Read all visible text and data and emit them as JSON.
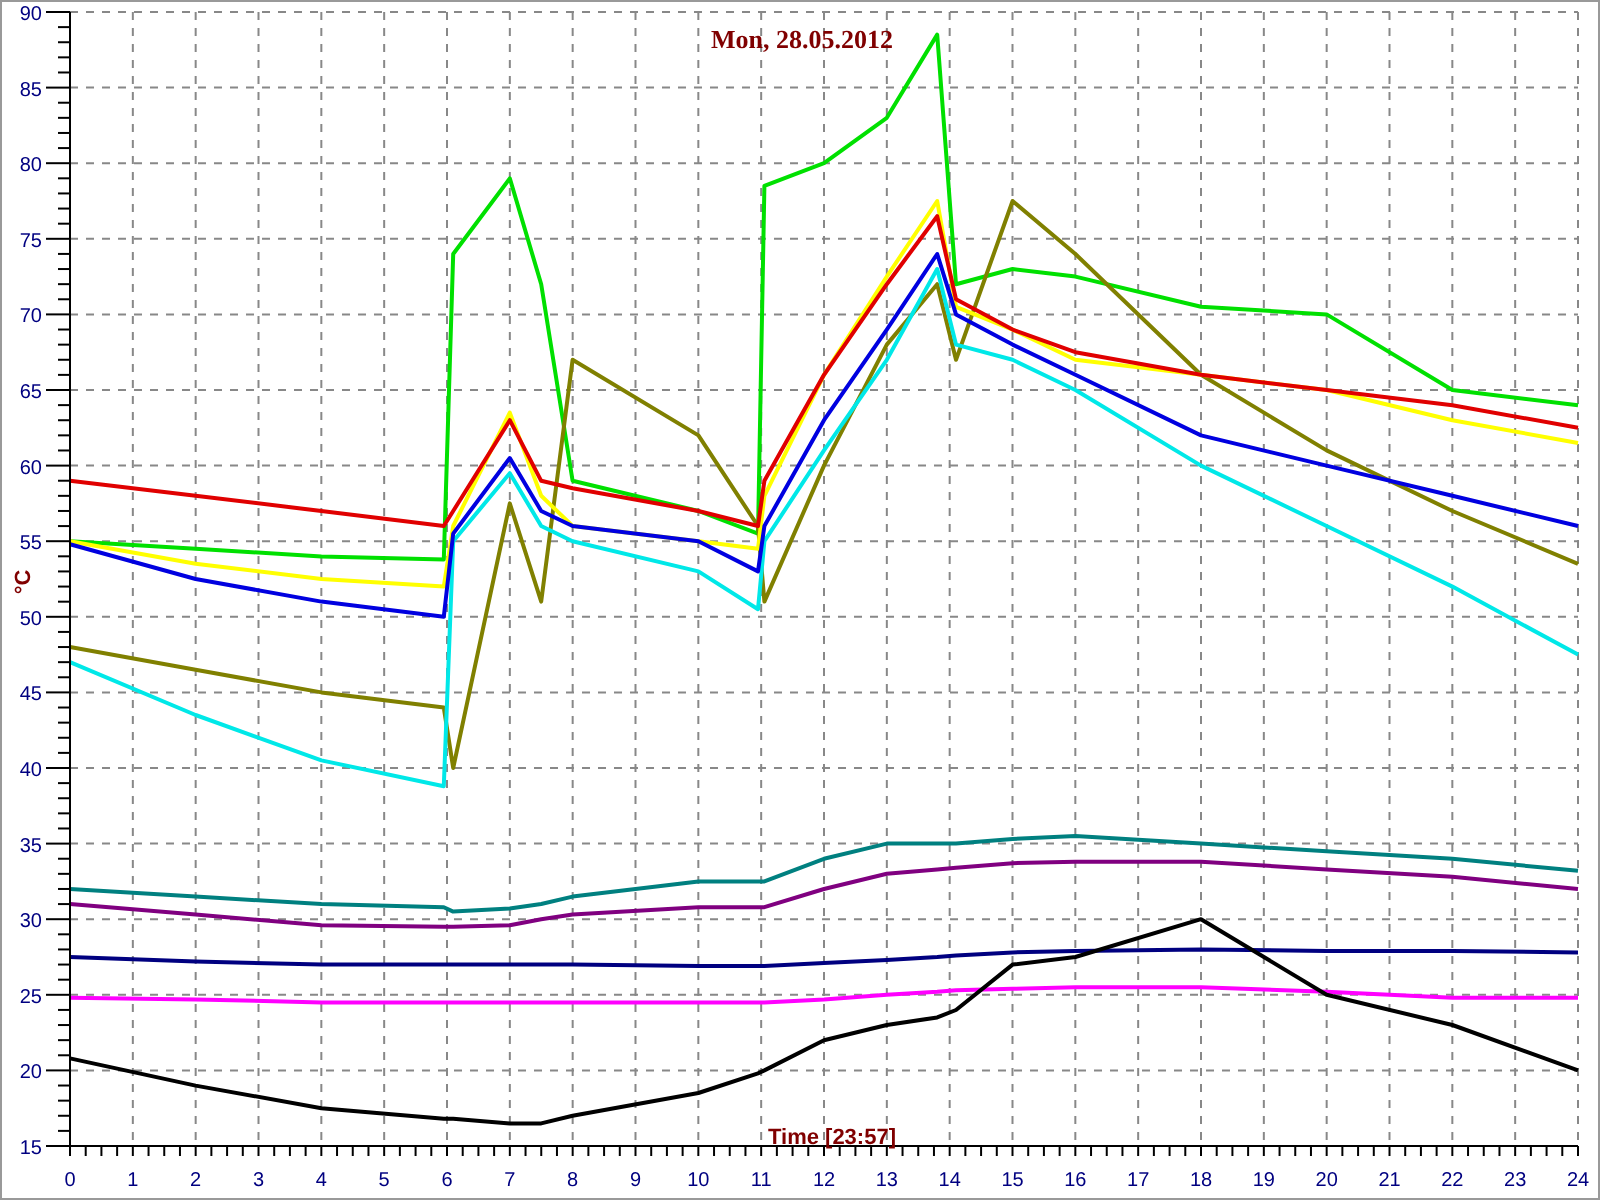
{
  "chart": {
    "chart_data": {
      "type": "line",
      "title": "Mon, 28.05.2012",
      "xlabel": "Time [23:57]",
      "ylabel": "°C",
      "x": [
        0,
        2,
        4,
        5.95,
        6.1,
        7,
        7.5,
        8,
        10,
        10.95,
        11.05,
        12,
        13,
        13.8,
        14.1,
        15,
        16,
        18,
        20,
        22,
        24
      ],
      "grid": true,
      "xlim": [
        0,
        24
      ],
      "ylim": [
        15,
        90
      ],
      "xticks": [
        0,
        1,
        2,
        3,
        4,
        5,
        6,
        7,
        8,
        9,
        10,
        11,
        12,
        13,
        14,
        15,
        16,
        17,
        18,
        19,
        20,
        21,
        22,
        23,
        24
      ],
      "yticks": [
        15,
        20,
        25,
        30,
        35,
        40,
        45,
        50,
        55,
        60,
        65,
        70,
        75,
        80,
        85,
        90
      ],
      "series": [
        {
          "color": "#00e000",
          "values": [
            55,
            54.5,
            54,
            53.8,
            74,
            79,
            72,
            59,
            57,
            55.5,
            78.5,
            80,
            83,
            88.5,
            72,
            73,
            72.5,
            70.5,
            70,
            65,
            64
          ]
        },
        {
          "color": "#808000",
          "values": [
            48,
            46.5,
            45,
            44,
            40,
            57.5,
            51,
            67,
            62,
            56,
            51,
            60,
            68,
            72,
            67,
            77.5,
            74,
            66,
            61,
            57,
            53.5
          ]
        },
        {
          "color": "#00e8e8",
          "values": [
            47,
            43.5,
            40.5,
            38.8,
            55,
            59.5,
            56,
            55,
            53,
            50.5,
            55,
            61,
            67,
            73,
            68,
            67,
            65,
            60,
            56,
            52,
            47.5
          ]
        },
        {
          "color": "#ffff00",
          "values": [
            55,
            53.5,
            52.5,
            52,
            56,
            63.5,
            58,
            56,
            55,
            54.5,
            58,
            66,
            72.5,
            77.5,
            70.5,
            69,
            67,
            66,
            65,
            63,
            61.5
          ]
        },
        {
          "color": "#0000e0",
          "values": [
            54.8,
            52.5,
            51,
            50,
            55.5,
            60.5,
            57,
            56,
            55,
            53,
            56,
            63,
            69,
            74,
            70,
            68,
            66,
            62,
            60,
            58,
            56
          ]
        },
        {
          "color": "#e00000",
          "values": [
            59,
            58,
            57,
            56,
            57,
            63,
            59,
            58.5,
            57,
            56,
            59,
            66,
            72,
            76.5,
            71,
            69,
            67.5,
            66,
            65,
            64,
            62.5
          ]
        },
        {
          "color": "#008080",
          "values": [
            32,
            31.5,
            31,
            30.8,
            30.5,
            30.7,
            31,
            31.5,
            32.5,
            32.5,
            32.5,
            34,
            35,
            35,
            35,
            35.3,
            35.5,
            35,
            34.5,
            34,
            33.2
          ]
        },
        {
          "color": "#800080",
          "values": [
            31,
            30.3,
            29.6,
            29.5,
            29.5,
            29.6,
            30,
            30.3,
            30.8,
            30.8,
            30.8,
            32,
            33,
            33.3,
            33.4,
            33.7,
            33.8,
            33.8,
            33.3,
            32.8,
            32
          ]
        },
        {
          "color": "#000080",
          "values": [
            27.5,
            27.2,
            27,
            27,
            27,
            27,
            27,
            27,
            26.9,
            26.9,
            26.9,
            27.1,
            27.3,
            27.5,
            27.6,
            27.8,
            27.9,
            28,
            27.9,
            27.9,
            27.8
          ]
        },
        {
          "color": "#ff00ff",
          "values": [
            24.8,
            24.7,
            24.5,
            24.5,
            24.5,
            24.5,
            24.5,
            24.5,
            24.5,
            24.5,
            24.5,
            24.7,
            25,
            25.2,
            25.3,
            25.4,
            25.5,
            25.5,
            25.2,
            24.8,
            24.8
          ]
        },
        {
          "color": "#000000",
          "values": [
            20.8,
            19,
            17.5,
            16.8,
            16.8,
            16.5,
            16.5,
            17,
            18.5,
            19.8,
            20,
            22,
            23,
            23.5,
            24,
            27,
            27.5,
            30,
            25,
            23,
            20
          ]
        }
      ]
    }
  }
}
